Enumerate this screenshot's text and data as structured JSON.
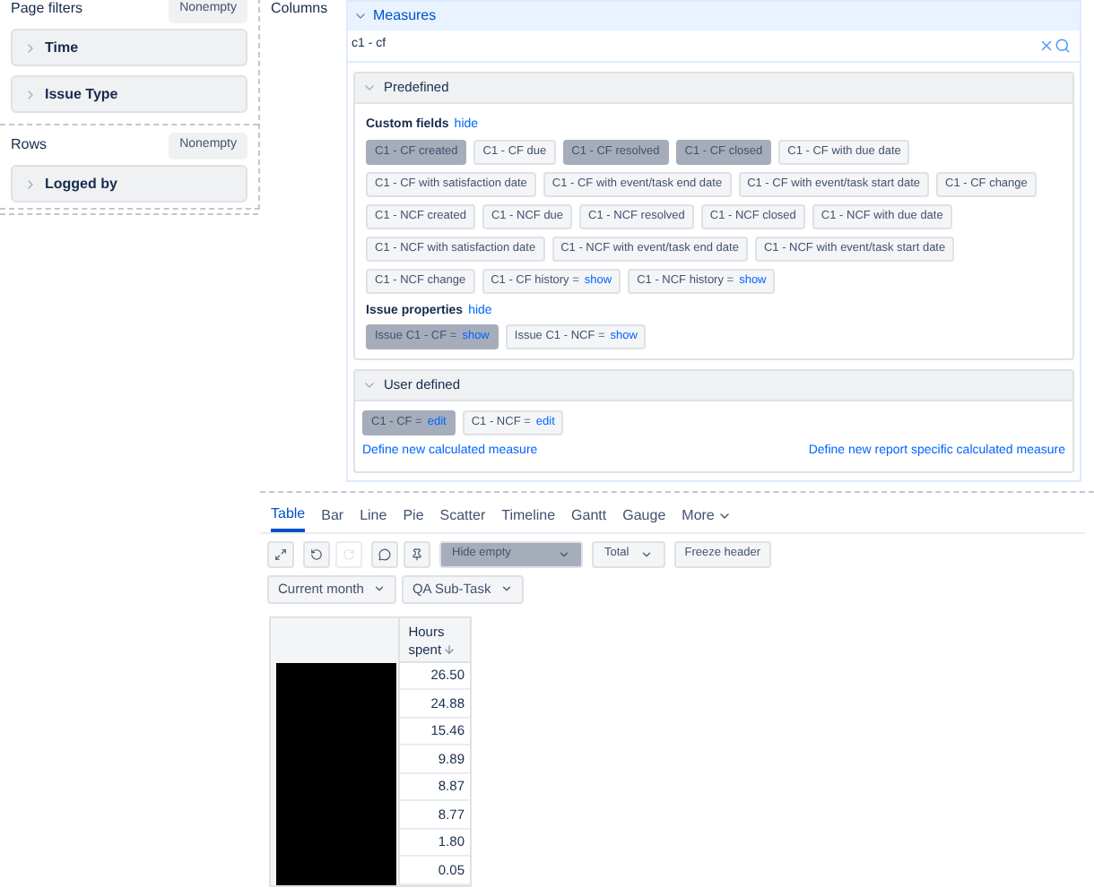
{
  "left_panel": {
    "page_filters": {
      "title": "Page filters",
      "button": "Nonempty",
      "items": [
        "Time",
        "Issue Type"
      ]
    },
    "rows": {
      "title": "Rows",
      "button": "Nonempty",
      "items": [
        "Logged by"
      ]
    }
  },
  "columns_label": "Columns",
  "measures": {
    "title": "Measures",
    "search": {
      "value": "c1 - cf"
    },
    "predefined": {
      "title": "Predefined",
      "groups": [
        {
          "title": "Custom fields",
          "toggle": "hide",
          "chips": [
            {
              "label": "C1 - CF created",
              "selected": true
            },
            {
              "label": "C1 - CF due",
              "selected": false
            },
            {
              "label": "C1 - CF resolved",
              "selected": true
            },
            {
              "label": "C1 - CF closed",
              "selected": true
            },
            {
              "label": "C1 - CF with due date",
              "selected": false
            },
            {
              "label": "C1 - CF with satisfaction date",
              "selected": false
            },
            {
              "label": "C1 - CF with event/task end date",
              "selected": false
            },
            {
              "label": "C1 - CF with event/task start date",
              "selected": false
            },
            {
              "label": "C1 - CF change",
              "selected": false
            },
            {
              "label": "C1 - NCF created",
              "selected": false
            },
            {
              "label": "C1 - NCF due",
              "selected": false
            },
            {
              "label": "C1 - NCF resolved",
              "selected": false
            },
            {
              "label": "C1 - NCF closed",
              "selected": false
            },
            {
              "label": "C1 - NCF with due date",
              "selected": false
            },
            {
              "label": "C1 - NCF with satisfaction date",
              "selected": false
            },
            {
              "label": "C1 - NCF with event/task end date",
              "selected": false
            },
            {
              "label": "C1 - NCF with event/task start date",
              "selected": false
            },
            {
              "label": "C1 - NCF change",
              "selected": false
            },
            {
              "label": "C1 - CF history =",
              "link": "show",
              "selected": false
            },
            {
              "label": "C1 - NCF history =",
              "link": "show",
              "selected": false
            }
          ]
        },
        {
          "title": "Issue properties",
          "toggle": "hide",
          "chips": [
            {
              "label": "Issue C1 - CF =",
              "link": "show",
              "selected": true
            },
            {
              "label": "Issue C1 - NCF =",
              "link": "show",
              "selected": false
            }
          ]
        }
      ]
    },
    "user_defined": {
      "title": "User defined",
      "chips": [
        {
          "label": "C1 - CF =",
          "link": "edit",
          "selected": true
        },
        {
          "label": "C1 - NCF =",
          "link": "edit",
          "selected": false
        }
      ],
      "links": [
        "Define new calculated measure",
        "Define new report specific calculated measure"
      ]
    }
  },
  "view_tabs": [
    {
      "label": "Table",
      "selected": true
    },
    {
      "label": "Bar",
      "selected": false
    },
    {
      "label": "Line",
      "selected": false
    },
    {
      "label": "Pie",
      "selected": false
    },
    {
      "label": "Scatter",
      "selected": false
    },
    {
      "label": "Timeline",
      "selected": false
    },
    {
      "label": "Gantt",
      "selected": false
    },
    {
      "label": "Gauge",
      "selected": false
    },
    {
      "label": "More",
      "selected": false
    }
  ],
  "toolbar": {
    "icons": [
      {
        "kind": "expand",
        "disabled": false
      },
      {
        "kind": "undo",
        "disabled": false
      },
      {
        "kind": "redo",
        "disabled": true
      },
      {
        "kind": "comment",
        "disabled": false
      },
      {
        "kind": "pin",
        "disabled": false
      }
    ],
    "dropdowns": [
      {
        "label": "Hide empty",
        "selected": true
      },
      {
        "label": "Total",
        "selected": false
      }
    ],
    "button": "Freeze header"
  },
  "filters": [
    "Current month",
    "QA Sub-Task"
  ],
  "table": {
    "column": "Hours spent",
    "values": [
      "26.50",
      "24.88",
      "15.46",
      "9.89",
      "8.87",
      "8.77",
      "1.80",
      "0.05"
    ]
  }
}
